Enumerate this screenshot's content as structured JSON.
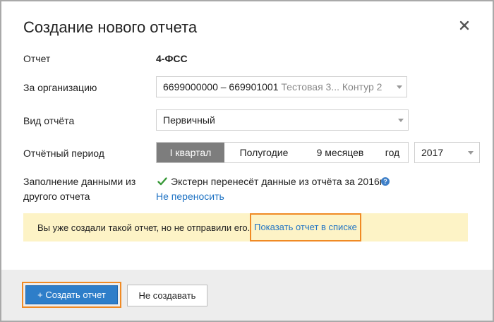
{
  "dialog": {
    "title": "Создание нового отчета",
    "close_icon": "close-icon"
  },
  "form": {
    "report": {
      "label": "Отчет",
      "value": "4-ФСС"
    },
    "organization": {
      "label": "За организацию",
      "value_main": "6699000000 – 669901001",
      "value_muted": "Тестовая 3... Контур 2"
    },
    "report_type": {
      "label": "Вид отчёта",
      "value": "Первичный"
    },
    "period": {
      "label": "Отчётный период",
      "options": [
        "I квартал",
        "Полугодие",
        "9 месяцев",
        "год"
      ],
      "selected": "I квартал",
      "year": "2017"
    },
    "fill": {
      "label_line1": "Заполнение данными из",
      "label_line2": "другого отчета",
      "transfer_text": "Экстерн перенесёт данные из отчёта за 2016г.",
      "help_icon": "question-icon",
      "no_transfer_link": "Не переносить"
    }
  },
  "notice": {
    "text": "Вы уже создали такой отчет, но не отправили его.",
    "link": "Показать отчет в списке"
  },
  "footer": {
    "create_label": "+ Создать отчет",
    "cancel_label": "Не создавать"
  },
  "colors": {
    "primary_button": "#2e7ec9",
    "link": "#1f73c4",
    "highlight_border": "#f08a24",
    "notice_bg": "#fdf3c6",
    "active_segment": "#7d7d7d",
    "check": "#3a9a3a"
  }
}
